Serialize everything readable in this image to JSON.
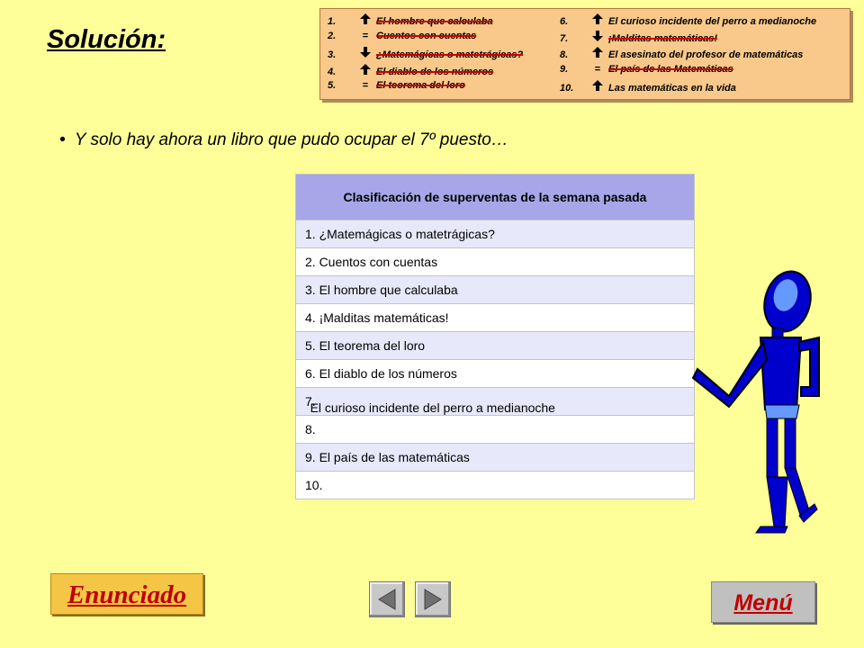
{
  "title": "Solución:",
  "card": {
    "left": [
      {
        "num": "1.",
        "sym": "up",
        "name": "El hombre que calculaba",
        "struck": true
      },
      {
        "num": "2.",
        "sym": "=",
        "name": "Cuentos con cuentas",
        "struck": true
      },
      {
        "num": "3.",
        "sym": "down",
        "name": "¿Matemágicas o matetrágicas?",
        "struck": true
      },
      {
        "num": "4.",
        "sym": "up",
        "name": "El diablo de los números",
        "struck": true
      },
      {
        "num": "5.",
        "sym": "=",
        "name": "El teorema del loro",
        "struck": true
      }
    ],
    "right": [
      {
        "num": "6.",
        "sym": "up",
        "name": "El curioso incidente del perro a medianoche",
        "struck": false
      },
      {
        "num": "7.",
        "sym": "down",
        "name": "¡Malditas matemáticas!",
        "struck": true
      },
      {
        "num": "8.",
        "sym": "up",
        "name": "El asesinato del profesor de matemáticas",
        "struck": false
      },
      {
        "num": "9.",
        "sym": "=",
        "name": "El país de las Matemáticas",
        "struck": true
      },
      {
        "num": "10.",
        "sym": "up",
        "name": "Las matemáticas en la vida",
        "struck": false
      }
    ]
  },
  "bullet": "Y solo hay ahora un libro que pudo ocupar el 7º puesto…",
  "table": {
    "header": "Clasificación de superventas de la semana pasada",
    "rows": [
      "1.  ¿Matemágicas o matetrágicas?",
      "2.  Cuentos con cuentas",
      "3.  El hombre que calculaba",
      "4.  ¡Malditas matemáticas!",
      "5.  El teorema del loro",
      "6. El diablo de los números",
      "7.",
      "8.",
      "9.  El país de las matemáticas",
      "10."
    ],
    "row7_extra": "El curioso incidente del perro a medianoche"
  },
  "buttons": {
    "enunciado": "Enunciado",
    "menu": "Menú"
  },
  "colors": {
    "background": "#ffff99",
    "card": "#f8c98a",
    "table_header": "#a6a6e8",
    "button_text": "#c00000",
    "figure": "#0000cc"
  }
}
